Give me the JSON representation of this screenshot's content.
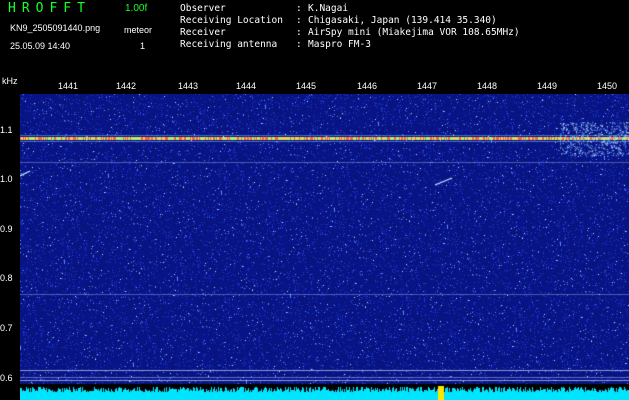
{
  "header": {
    "app_title": "HROFFT",
    "version": "1.00f",
    "filename": "KN9_2505091440.png",
    "meteor_label": "meteor",
    "datetime": "25.05.09 14:40",
    "meteor_count": "1",
    "info": [
      {
        "key": "Observer",
        "value": "K.Nagai"
      },
      {
        "key": "Receiving Location",
        "value": "Chigasaki, Japan (139.414 35.340)"
      },
      {
        "key": "Receiver",
        "value": "AirSpy mini (Miakejima VOR 108.65MHz)"
      },
      {
        "key": "Receiving antenna",
        "value": "Maspro FM-3"
      }
    ]
  },
  "axes": {
    "y_unit": "kHz",
    "y_ticks": [
      "1.1",
      "1.0",
      "0.9",
      "0.8",
      "0.7",
      "0.6"
    ],
    "x_ticks": [
      "1441",
      "1442",
      "1443",
      "1444",
      "1445",
      "1446",
      "1447",
      "1448",
      "1449",
      "1450"
    ]
  },
  "colors": {
    "background": "#000000",
    "noise_floor": "#0a1a8a",
    "carrier": "#ff6040",
    "spectrum": "#00e5ff",
    "title_green": "#19ff2a"
  }
}
